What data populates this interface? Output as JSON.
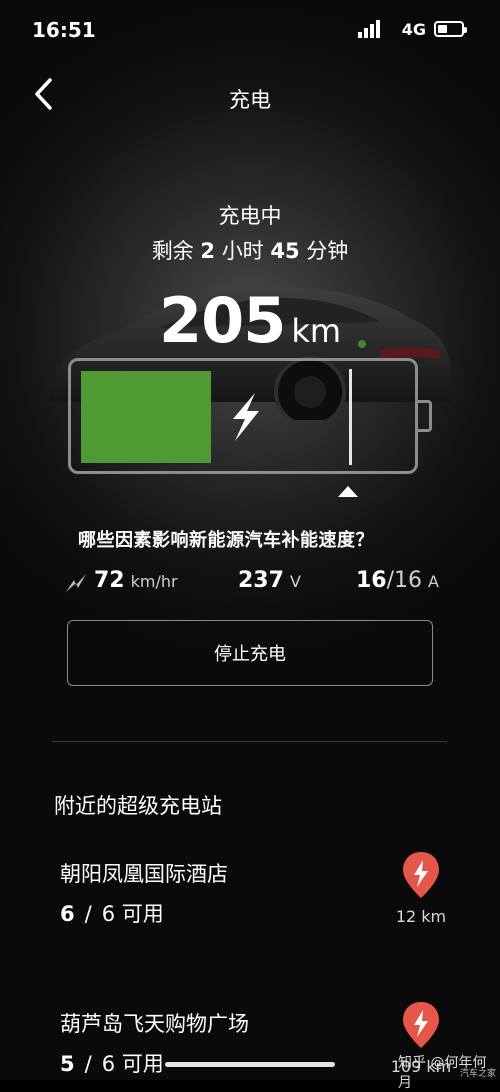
{
  "status_bar": {
    "time": "16:51",
    "network": "4G"
  },
  "header": {
    "title": "充电"
  },
  "charging": {
    "state": "充电中",
    "remaining": {
      "prefix": "剩余",
      "hours": "2",
      "hours_unit": "小时",
      "minutes": "45",
      "minutes_unit": "分钟"
    },
    "range_value": "205",
    "range_unit": "km",
    "charge_level": 0.4,
    "charge_limit": 0.8,
    "colors": {
      "fill": "#4f9a33",
      "outline": "#8d8d8d"
    }
  },
  "overlay_caption": "哪些因素影响新能源汽车补能速度？",
  "stats": {
    "speed": {
      "value": "72",
      "unit": "km/hr",
      "icon": "charging-bolt-icon"
    },
    "voltage": {
      "value": "237",
      "unit": "V"
    },
    "current": {
      "value": "16",
      "max": "/16",
      "unit": "A"
    }
  },
  "stop_button": {
    "label": "停止充电"
  },
  "nearby": {
    "title": "附近的超级充电站",
    "stations": [
      {
        "name": "朝阳凤凰国际酒店",
        "available": "6",
        "separator": "/",
        "total": "6",
        "suffix": "可用",
        "distance": "12 km",
        "pin_color": "#e5574a"
      },
      {
        "name": "葫芦岛飞天购物广场",
        "available": "5",
        "separator": "/",
        "total": "6",
        "suffix": "可用",
        "distance": "109 km",
        "pin_color": "#e5574a"
      }
    ]
  },
  "watermark": {
    "text": "知乎 @何年何月",
    "sub": "汽车之家"
  }
}
